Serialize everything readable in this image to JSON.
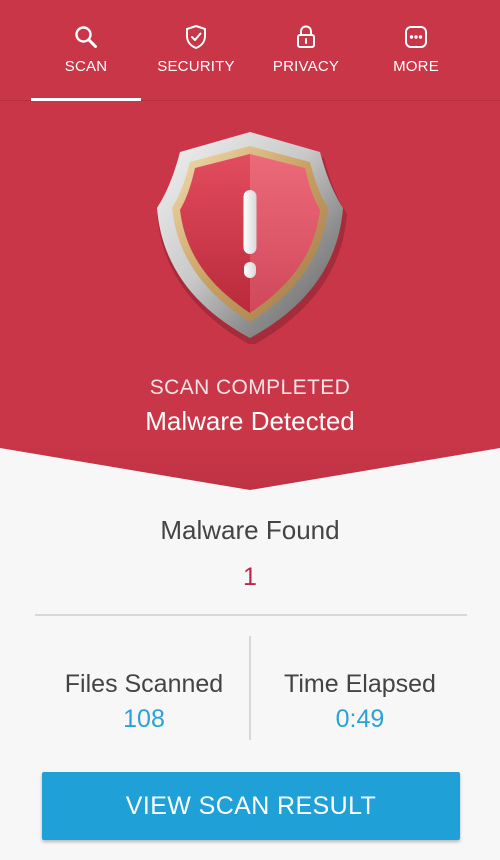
{
  "tabs": [
    {
      "label": "SCAN",
      "icon": "search-icon",
      "active": true
    },
    {
      "label": "SECURITY",
      "icon": "shield-check-icon",
      "active": false
    },
    {
      "label": "PRIVACY",
      "icon": "lock-icon",
      "active": false
    },
    {
      "label": "MORE",
      "icon": "more-dots-icon",
      "active": false
    }
  ],
  "status": {
    "line1": "SCAN COMPLETED",
    "line2": "Malware Detected",
    "shield_icon": "warning-shield-icon"
  },
  "results": {
    "malware_label": "Malware Found",
    "malware_count": "1",
    "files_label": "Files Scanned",
    "files_value": "108",
    "time_label": "Time Elapsed",
    "time_value": "0:49"
  },
  "action": {
    "button_label": "VIEW SCAN RESULT"
  },
  "colors": {
    "header_red": "#c93648",
    "accent_blue": "#1fa1d8",
    "value_blue": "#2aa2d9",
    "count_red": "#c0264b"
  }
}
